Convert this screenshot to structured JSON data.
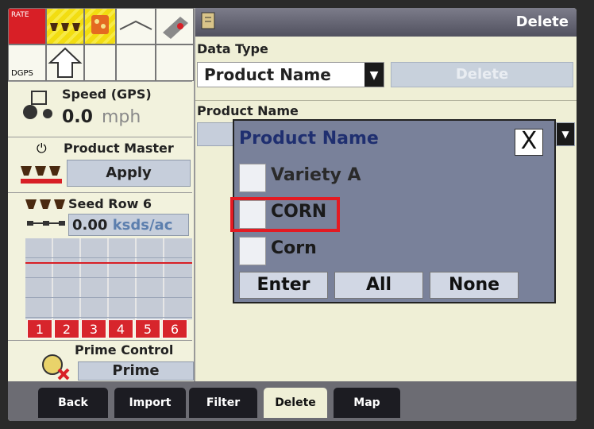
{
  "left_panel": {
    "status_icons": {
      "rate_label": "RATE",
      "dgps_label": "DGPS"
    },
    "speed": {
      "label": "Speed (GPS)",
      "value": "0.0",
      "unit": "mph"
    },
    "product_master": {
      "label": "Product Master",
      "button": "Apply"
    },
    "seed_row": {
      "label": "Seed Row 6",
      "value": "0.00",
      "unit": "ksds/ac"
    },
    "row_numbers": [
      "1",
      "2",
      "3",
      "4",
      "5",
      "6"
    ],
    "prime_control": {
      "label": "Prime Control",
      "button": "Prime"
    }
  },
  "header": {
    "title": "Delete"
  },
  "main": {
    "data_type": {
      "label": "Data Type",
      "value": "Product Name"
    },
    "delete_button": "Delete",
    "product_name_label": "Product Name"
  },
  "popup": {
    "title": "Product Name",
    "close": "X",
    "items": [
      {
        "label": "Variety A",
        "checked": false
      },
      {
        "label": "CORN",
        "checked": false,
        "highlighted": true
      },
      {
        "label": "Corn",
        "checked": false
      }
    ],
    "buttons": {
      "enter": "Enter",
      "all": "All",
      "none": "None"
    }
  },
  "tabs": [
    {
      "label": "Back",
      "active": false
    },
    {
      "label": "Import",
      "active": false
    },
    {
      "label": "Filter",
      "active": false
    },
    {
      "label": "Delete",
      "active": true
    },
    {
      "label": "Map",
      "active": false
    }
  ],
  "colors": {
    "accent_red": "#d81f26",
    "popup_bg": "#79819a",
    "title_blue": "#1f2f70"
  }
}
